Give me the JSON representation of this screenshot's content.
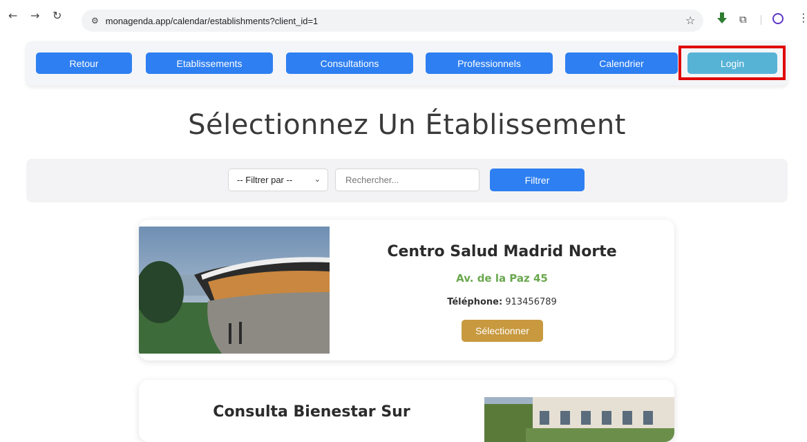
{
  "browser": {
    "url": "monagenda.app/calendar/establishments?client_id=1"
  },
  "nav": {
    "buttons": [
      "Retour",
      "Etablissements",
      "Consultations",
      "Professionnels",
      "Calendrier",
      "Login"
    ]
  },
  "page": {
    "title": "Sélectionnez Un Établissement"
  },
  "filter": {
    "select_value": "-- Filtrer par --",
    "search_placeholder": "Rechercher...",
    "button_label": "Filtrer"
  },
  "establishments": [
    {
      "name": "Centro Salud Madrid Norte",
      "address": "Av. de la Paz 45",
      "phone_label": "Téléphone:",
      "phone": "913456789",
      "select_label": "Sélectionner"
    },
    {
      "name": "Consulta Bienestar Sur"
    }
  ],
  "colors": {
    "primary": "#2e7ff1",
    "login": "#56b3d6",
    "highlight": "#e00000",
    "address": "#6aa84f",
    "select": "#c8993f"
  }
}
